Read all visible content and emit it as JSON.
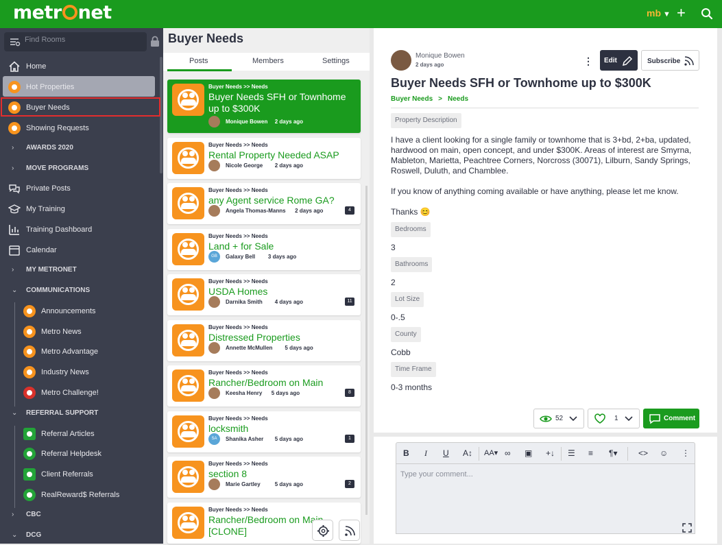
{
  "topbar": {
    "logo": "metr net",
    "user_initials": "mb",
    "caret": "▼",
    "plus": "+"
  },
  "sidebar": {
    "search_placeholder": "Find Rooms",
    "items": [
      {
        "label": "Home"
      },
      {
        "label": "Hot Properties"
      },
      {
        "label": "Buyer Needs"
      },
      {
        "label": "Showing Requests"
      },
      {
        "label": "AWARDS 2020"
      },
      {
        "label": "MOVE PROGRAMS"
      },
      {
        "label": "Private Posts"
      },
      {
        "label": "My Training"
      },
      {
        "label": "Training Dashboard"
      },
      {
        "label": "Calendar"
      },
      {
        "label": "MY METRONET"
      },
      {
        "label": "COMMUNICATIONS"
      },
      {
        "label": "Announcements"
      },
      {
        "label": "Metro News"
      },
      {
        "label": "Metro Advantage"
      },
      {
        "label": "Industry News"
      },
      {
        "label": "Metro Challenge!"
      },
      {
        "label": "REFERRAL SUPPORT"
      },
      {
        "label": "Referral Articles"
      },
      {
        "label": "Referral Helpdesk"
      },
      {
        "label": "Client Referrals"
      },
      {
        "label": "RealReward$ Referrals"
      },
      {
        "label": "CBC"
      },
      {
        "label": "DCG"
      }
    ]
  },
  "room": {
    "title": "Buyer Needs",
    "tabs": [
      {
        "label": "Posts"
      },
      {
        "label": "Members"
      },
      {
        "label": "Settings"
      }
    ]
  },
  "posts": [
    {
      "crumb": "Buyer Needs >> Needs",
      "title": "Buyer Needs SFH or Townhome up to $300K",
      "author": "Monique Bowen",
      "time": "2 days ago",
      "count": ""
    },
    {
      "crumb": "Buyer Needs >> Needs",
      "title": "Rental Property Needed ASAP",
      "author": "Nicole George",
      "time": "2 days ago",
      "count": ""
    },
    {
      "crumb": "Buyer Needs >> Needs",
      "title": "any Agent service Rome GA?",
      "author": "Angela Thomas-Manns",
      "time": "2 days ago",
      "count": "4"
    },
    {
      "crumb": "Buyer Needs >> Needs",
      "title": "Land + for Sale",
      "author": "Galaxy Bell",
      "time": "3 days ago",
      "count": "",
      "initials": "GB"
    },
    {
      "crumb": "Buyer Needs >> Needs",
      "title": "USDA Homes",
      "author": "Darnika Smith",
      "time": "4 days ago",
      "count": "11"
    },
    {
      "crumb": "Buyer Needs >> Needs",
      "title": "Distressed Properties",
      "author": "Annette McMullen",
      "time": "5 days ago",
      "count": ""
    },
    {
      "crumb": "Buyer Needs >> Needs",
      "title": "Rancher/Bedroom on Main",
      "author": "Keesha Henry",
      "time": "5 days ago",
      "count": "8"
    },
    {
      "crumb": "Buyer Needs >> Needs",
      "title": "locksmith",
      "author": "Shanika Asher",
      "time": "5 days ago",
      "count": "1",
      "initials": "SA"
    },
    {
      "crumb": "Buyer Needs >> Needs",
      "title": "section 8",
      "author": "Marie Gartley",
      "time": "5 days ago",
      "count": "2"
    },
    {
      "crumb": "Buyer Needs >> Needs",
      "title": "Rancher/Bedroom on Main [CLONE]",
      "author": "",
      "time": "",
      "count": ""
    }
  ],
  "detail": {
    "author": "Monique Bowen",
    "time": "2 days ago",
    "kebab": "⋮",
    "edit_label": "Edit",
    "subscribe_label": "Subscribe",
    "title": "Buyer Needs SFH or Townhome up to $300K",
    "breadcrumb": [
      "Buyer Needs",
      "Needs"
    ],
    "breadcrumb_sep": ">",
    "description_label": "Property Description",
    "description": "I have a client looking for a single family or townhome that is 3+bd, 2+ba, updated, hardwood on main, open concept, and under $300K. Areas of interest are Smyrna, Mableton, Marietta, Peachtree Corners, Norcross (30071), Lilburn, Sandy Springs, Roswell, Duluth, and Chamblee.",
    "description2": "If you know of anything coming available or have anything, please let me know.",
    "thanks": "Thanks 😊",
    "fields": [
      {
        "label": "Bedrooms",
        "value": "3"
      },
      {
        "label": "Bathrooms",
        "value": "2"
      },
      {
        "label": "Lot Size",
        "value": "0-.5"
      },
      {
        "label": "County",
        "value": "Cobb"
      },
      {
        "label": "Time Frame",
        "value": "0-3 months"
      }
    ],
    "views": "52",
    "likes": "1",
    "comment_label": "Comment"
  },
  "editor": {
    "placeholder": "Type your comment..."
  },
  "colors": {
    "brand_green": "#1a9b1e",
    "sidebar": "#3b3f4d",
    "accent_orange": "#f7931e",
    "selection_red": "#e52d2d"
  }
}
